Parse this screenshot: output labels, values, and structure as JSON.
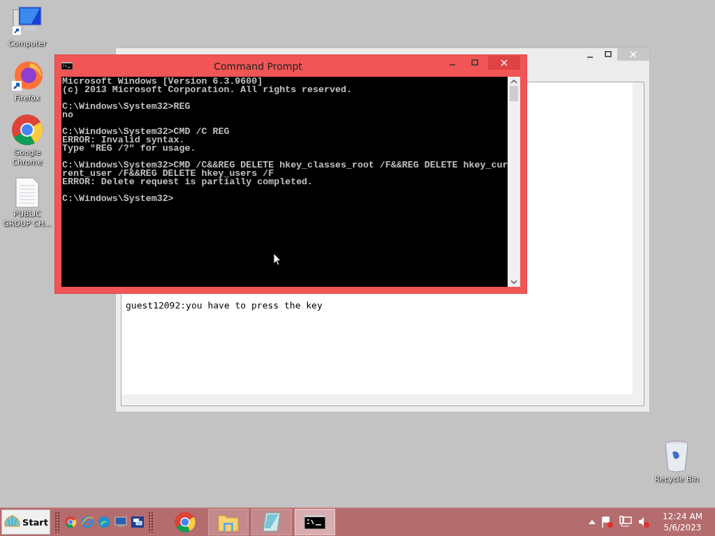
{
  "desktop_icons": [
    {
      "kind": "computer",
      "label": "Computer"
    },
    {
      "kind": "firefox",
      "label": "Firefox"
    },
    {
      "kind": "chrome",
      "label": "Google Chrome"
    },
    {
      "kind": "document",
      "label": "PUBLIC GROUP CH..."
    }
  ],
  "recycle_bin": {
    "label": "Recycle Bin"
  },
  "notepad": {
    "text": "guest12092:you have to press the key"
  },
  "command_prompt": {
    "title": "Command Prompt",
    "blocks": [
      [
        "Microsoft Windows [Version 6.3.9600]",
        "(c) 2013 Microsoft Corporation. All rights reserved."
      ],
      [
        "C:\\Windows\\System32>REG",
        "no"
      ],
      [
        "C:\\Windows\\System32>CMD /C REG",
        "ERROR: Invalid syntax.",
        "Type \"REG /?\" for usage."
      ],
      [
        "C:\\Windows\\System32>CMD /C&&REG DELETE hkey_classes_root /F&&REG DELETE hkey_cur",
        "rent_user /F&&REG DELETE hkey_users /F",
        "ERROR: Delete request is partially completed."
      ],
      [
        "C:\\Windows\\System32>"
      ]
    ]
  },
  "taskbar": {
    "start": "Start",
    "quick_launch": [
      {
        "kind": "chrome"
      },
      {
        "kind": "ie"
      },
      {
        "kind": "edge"
      },
      {
        "kind": "desktop"
      },
      {
        "kind": "switch"
      }
    ],
    "apps": [
      {
        "kind": "chrome",
        "selected": false
      },
      {
        "kind": "explorer",
        "selected": false
      },
      {
        "kind": "notepad",
        "selected": false
      },
      {
        "kind": "cmd",
        "selected": true
      }
    ],
    "clock": {
      "time": "12:24 AM",
      "date": "5/6/2023"
    }
  }
}
